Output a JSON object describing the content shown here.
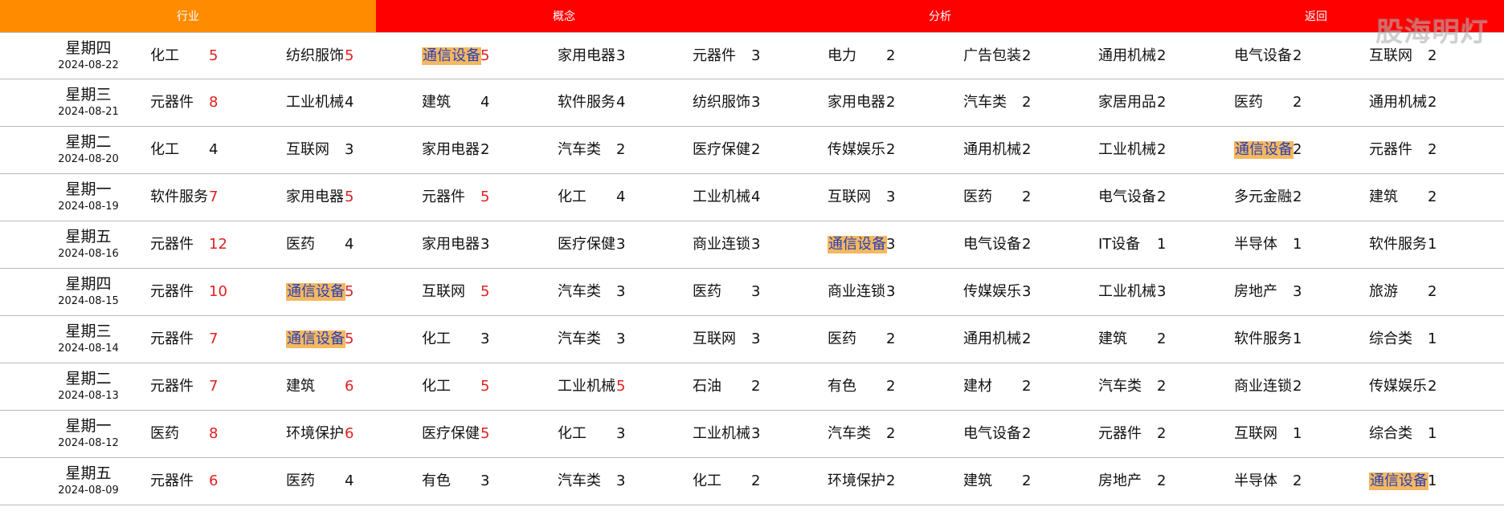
{
  "header": {
    "tabs": [
      {
        "label": "行业"
      },
      {
        "label": "概念"
      },
      {
        "label": "分析"
      },
      {
        "label": "返回"
      }
    ],
    "brand": "股海明灯"
  },
  "rows": [
    {
      "weekday": "星期四",
      "date": "2024-08-22",
      "sectors": [
        {
          "name": "化工",
          "count": "5"
        },
        {
          "name": "纺织服饰",
          "count": "5"
        },
        {
          "name": "通信设备",
          "count": "5"
        },
        {
          "name": "家用电器",
          "count": "3"
        },
        {
          "name": "元器件",
          "count": "3"
        },
        {
          "name": "电力",
          "count": "2"
        },
        {
          "name": "广告包装",
          "count": "2"
        },
        {
          "name": "通用机械",
          "count": "2"
        },
        {
          "name": "电气设备",
          "count": "2"
        },
        {
          "name": "互联网",
          "count": "2"
        }
      ]
    },
    {
      "weekday": "星期三",
      "date": "2024-08-21",
      "sectors": [
        {
          "name": "元器件",
          "count": "8"
        },
        {
          "name": "工业机械",
          "count": "4"
        },
        {
          "name": "建筑",
          "count": "4"
        },
        {
          "name": "软件服务",
          "count": "4"
        },
        {
          "name": "纺织服饰",
          "count": "3"
        },
        {
          "name": "家用电器",
          "count": "2"
        },
        {
          "name": "汽车类",
          "count": "2"
        },
        {
          "name": "家居用品",
          "count": "2"
        },
        {
          "name": "医药",
          "count": "2"
        },
        {
          "name": "通用机械",
          "count": "2"
        }
      ]
    },
    {
      "weekday": "星期二",
      "date": "2024-08-20",
      "sectors": [
        {
          "name": "化工",
          "count": "4"
        },
        {
          "name": "互联网",
          "count": "3"
        },
        {
          "name": "家用电器",
          "count": "2"
        },
        {
          "name": "汽车类",
          "count": "2"
        },
        {
          "name": "医疗保健",
          "count": "2"
        },
        {
          "name": "传媒娱乐",
          "count": "2"
        },
        {
          "name": "通用机械",
          "count": "2"
        },
        {
          "name": "工业机械",
          "count": "2"
        },
        {
          "name": "通信设备",
          "count": "2"
        },
        {
          "name": "元器件",
          "count": "2"
        }
      ]
    },
    {
      "weekday": "星期一",
      "date": "2024-08-19",
      "sectors": [
        {
          "name": "软件服务",
          "count": "7"
        },
        {
          "name": "家用电器",
          "count": "5"
        },
        {
          "name": "元器件",
          "count": "5"
        },
        {
          "name": "化工",
          "count": "4"
        },
        {
          "name": "工业机械",
          "count": "4"
        },
        {
          "name": "互联网",
          "count": "3"
        },
        {
          "name": "医药",
          "count": "2"
        },
        {
          "name": "电气设备",
          "count": "2"
        },
        {
          "name": "多元金融",
          "count": "2"
        },
        {
          "name": "建筑",
          "count": "2"
        }
      ]
    },
    {
      "weekday": "星期五",
      "date": "2024-08-16",
      "sectors": [
        {
          "name": "元器件",
          "count": "12"
        },
        {
          "name": "医药",
          "count": "4"
        },
        {
          "name": "家用电器",
          "count": "3"
        },
        {
          "name": "医疗保健",
          "count": "3"
        },
        {
          "name": "商业连锁",
          "count": "3"
        },
        {
          "name": "通信设备",
          "count": "3"
        },
        {
          "name": "电气设备",
          "count": "2"
        },
        {
          "name": "IT设备",
          "count": "1"
        },
        {
          "name": "半导体",
          "count": "1"
        },
        {
          "name": "软件服务",
          "count": "1"
        }
      ]
    },
    {
      "weekday": "星期四",
      "date": "2024-08-15",
      "sectors": [
        {
          "name": "元器件",
          "count": "10"
        },
        {
          "name": "通信设备",
          "count": "5"
        },
        {
          "name": "互联网",
          "count": "5"
        },
        {
          "name": "汽车类",
          "count": "3"
        },
        {
          "name": "医药",
          "count": "3"
        },
        {
          "name": "商业连锁",
          "count": "3"
        },
        {
          "name": "传媒娱乐",
          "count": "3"
        },
        {
          "name": "工业机械",
          "count": "3"
        },
        {
          "name": "房地产",
          "count": "3"
        },
        {
          "name": "旅游",
          "count": "2"
        }
      ]
    },
    {
      "weekday": "星期三",
      "date": "2024-08-14",
      "sectors": [
        {
          "name": "元器件",
          "count": "7"
        },
        {
          "name": "通信设备",
          "count": "5"
        },
        {
          "name": "化工",
          "count": "3"
        },
        {
          "name": "汽车类",
          "count": "3"
        },
        {
          "name": "互联网",
          "count": "3"
        },
        {
          "name": "医药",
          "count": "2"
        },
        {
          "name": "通用机械",
          "count": "2"
        },
        {
          "name": "建筑",
          "count": "2"
        },
        {
          "name": "软件服务",
          "count": "1"
        },
        {
          "name": "综合类",
          "count": "1"
        }
      ]
    },
    {
      "weekday": "星期二",
      "date": "2024-08-13",
      "sectors": [
        {
          "name": "元器件",
          "count": "7"
        },
        {
          "name": "建筑",
          "count": "6"
        },
        {
          "name": "化工",
          "count": "5"
        },
        {
          "name": "工业机械",
          "count": "5"
        },
        {
          "name": "石油",
          "count": "2"
        },
        {
          "name": "有色",
          "count": "2"
        },
        {
          "name": "建材",
          "count": "2"
        },
        {
          "name": "汽车类",
          "count": "2"
        },
        {
          "name": "商业连锁",
          "count": "2"
        },
        {
          "name": "传媒娱乐",
          "count": "2"
        }
      ]
    },
    {
      "weekday": "星期一",
      "date": "2024-08-12",
      "sectors": [
        {
          "name": "医药",
          "count": "8"
        },
        {
          "name": "环境保护",
          "count": "6"
        },
        {
          "name": "医疗保健",
          "count": "5"
        },
        {
          "name": "化工",
          "count": "3"
        },
        {
          "name": "工业机械",
          "count": "3"
        },
        {
          "name": "汽车类",
          "count": "2"
        },
        {
          "name": "电气设备",
          "count": "2"
        },
        {
          "name": "元器件",
          "count": "2"
        },
        {
          "name": "互联网",
          "count": "1"
        },
        {
          "name": "综合类",
          "count": "1"
        }
      ]
    },
    {
      "weekday": "星期五",
      "date": "2024-08-09",
      "sectors": [
        {
          "name": "元器件",
          "count": "6"
        },
        {
          "name": "医药",
          "count": "4"
        },
        {
          "name": "有色",
          "count": "3"
        },
        {
          "name": "汽车类",
          "count": "3"
        },
        {
          "name": "化工",
          "count": "2"
        },
        {
          "name": "环境保护",
          "count": "2"
        },
        {
          "name": "建筑",
          "count": "2"
        },
        {
          "name": "房地产",
          "count": "2"
        },
        {
          "name": "半导体",
          "count": "2"
        },
        {
          "name": "通信设备",
          "count": "1"
        }
      ]
    }
  ]
}
